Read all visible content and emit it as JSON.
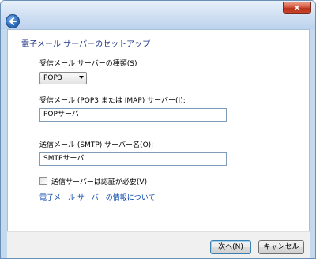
{
  "window": {
    "close_label": "x"
  },
  "wizard": {
    "title": "電子メール サーバーのセットアップ",
    "incoming_type_label": "受信メール サーバーの種類(S)",
    "incoming_type_value": "POP3",
    "incoming_server_label": "受信メール (POP3 または IMAP) サーバー(I):",
    "incoming_server_value": "POPサーバ",
    "outgoing_server_label": "送信メール (SMTP) サーバー名(O):",
    "outgoing_server_value": "SMTPサーバ",
    "auth_checkbox_label": "送信サーバーは認証が必要(V)",
    "info_link": "電子メール サーバーの情報について"
  },
  "footer": {
    "next_label": "次へ(N)",
    "cancel_label": "キャンセル"
  }
}
